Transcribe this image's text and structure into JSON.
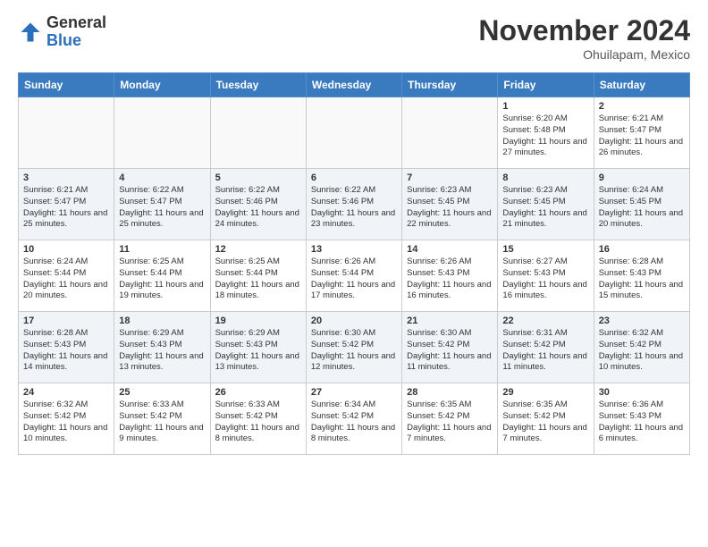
{
  "logo": {
    "general": "General",
    "blue": "Blue"
  },
  "header": {
    "month": "November 2024",
    "location": "Ohuilapam, Mexico"
  },
  "weekdays": [
    "Sunday",
    "Monday",
    "Tuesday",
    "Wednesday",
    "Thursday",
    "Friday",
    "Saturday"
  ],
  "weeks": [
    [
      {
        "day": "",
        "info": ""
      },
      {
        "day": "",
        "info": ""
      },
      {
        "day": "",
        "info": ""
      },
      {
        "day": "",
        "info": ""
      },
      {
        "day": "",
        "info": ""
      },
      {
        "day": "1",
        "info": "Sunrise: 6:20 AM\nSunset: 5:48 PM\nDaylight: 11 hours and 27 minutes."
      },
      {
        "day": "2",
        "info": "Sunrise: 6:21 AM\nSunset: 5:47 PM\nDaylight: 11 hours and 26 minutes."
      }
    ],
    [
      {
        "day": "3",
        "info": "Sunrise: 6:21 AM\nSunset: 5:47 PM\nDaylight: 11 hours and 25 minutes."
      },
      {
        "day": "4",
        "info": "Sunrise: 6:22 AM\nSunset: 5:47 PM\nDaylight: 11 hours and 25 minutes."
      },
      {
        "day": "5",
        "info": "Sunrise: 6:22 AM\nSunset: 5:46 PM\nDaylight: 11 hours and 24 minutes."
      },
      {
        "day": "6",
        "info": "Sunrise: 6:22 AM\nSunset: 5:46 PM\nDaylight: 11 hours and 23 minutes."
      },
      {
        "day": "7",
        "info": "Sunrise: 6:23 AM\nSunset: 5:45 PM\nDaylight: 11 hours and 22 minutes."
      },
      {
        "day": "8",
        "info": "Sunrise: 6:23 AM\nSunset: 5:45 PM\nDaylight: 11 hours and 21 minutes."
      },
      {
        "day": "9",
        "info": "Sunrise: 6:24 AM\nSunset: 5:45 PM\nDaylight: 11 hours and 20 minutes."
      }
    ],
    [
      {
        "day": "10",
        "info": "Sunrise: 6:24 AM\nSunset: 5:44 PM\nDaylight: 11 hours and 20 minutes."
      },
      {
        "day": "11",
        "info": "Sunrise: 6:25 AM\nSunset: 5:44 PM\nDaylight: 11 hours and 19 minutes."
      },
      {
        "day": "12",
        "info": "Sunrise: 6:25 AM\nSunset: 5:44 PM\nDaylight: 11 hours and 18 minutes."
      },
      {
        "day": "13",
        "info": "Sunrise: 6:26 AM\nSunset: 5:44 PM\nDaylight: 11 hours and 17 minutes."
      },
      {
        "day": "14",
        "info": "Sunrise: 6:26 AM\nSunset: 5:43 PM\nDaylight: 11 hours and 16 minutes."
      },
      {
        "day": "15",
        "info": "Sunrise: 6:27 AM\nSunset: 5:43 PM\nDaylight: 11 hours and 16 minutes."
      },
      {
        "day": "16",
        "info": "Sunrise: 6:28 AM\nSunset: 5:43 PM\nDaylight: 11 hours and 15 minutes."
      }
    ],
    [
      {
        "day": "17",
        "info": "Sunrise: 6:28 AM\nSunset: 5:43 PM\nDaylight: 11 hours and 14 minutes."
      },
      {
        "day": "18",
        "info": "Sunrise: 6:29 AM\nSunset: 5:43 PM\nDaylight: 11 hours and 13 minutes."
      },
      {
        "day": "19",
        "info": "Sunrise: 6:29 AM\nSunset: 5:43 PM\nDaylight: 11 hours and 13 minutes."
      },
      {
        "day": "20",
        "info": "Sunrise: 6:30 AM\nSunset: 5:42 PM\nDaylight: 11 hours and 12 minutes."
      },
      {
        "day": "21",
        "info": "Sunrise: 6:30 AM\nSunset: 5:42 PM\nDaylight: 11 hours and 11 minutes."
      },
      {
        "day": "22",
        "info": "Sunrise: 6:31 AM\nSunset: 5:42 PM\nDaylight: 11 hours and 11 minutes."
      },
      {
        "day": "23",
        "info": "Sunrise: 6:32 AM\nSunset: 5:42 PM\nDaylight: 11 hours and 10 minutes."
      }
    ],
    [
      {
        "day": "24",
        "info": "Sunrise: 6:32 AM\nSunset: 5:42 PM\nDaylight: 11 hours and 10 minutes."
      },
      {
        "day": "25",
        "info": "Sunrise: 6:33 AM\nSunset: 5:42 PM\nDaylight: 11 hours and 9 minutes."
      },
      {
        "day": "26",
        "info": "Sunrise: 6:33 AM\nSunset: 5:42 PM\nDaylight: 11 hours and 8 minutes."
      },
      {
        "day": "27",
        "info": "Sunrise: 6:34 AM\nSunset: 5:42 PM\nDaylight: 11 hours and 8 minutes."
      },
      {
        "day": "28",
        "info": "Sunrise: 6:35 AM\nSunset: 5:42 PM\nDaylight: 11 hours and 7 minutes."
      },
      {
        "day": "29",
        "info": "Sunrise: 6:35 AM\nSunset: 5:42 PM\nDaylight: 11 hours and 7 minutes."
      },
      {
        "day": "30",
        "info": "Sunrise: 6:36 AM\nSunset: 5:43 PM\nDaylight: 11 hours and 6 minutes."
      }
    ]
  ]
}
